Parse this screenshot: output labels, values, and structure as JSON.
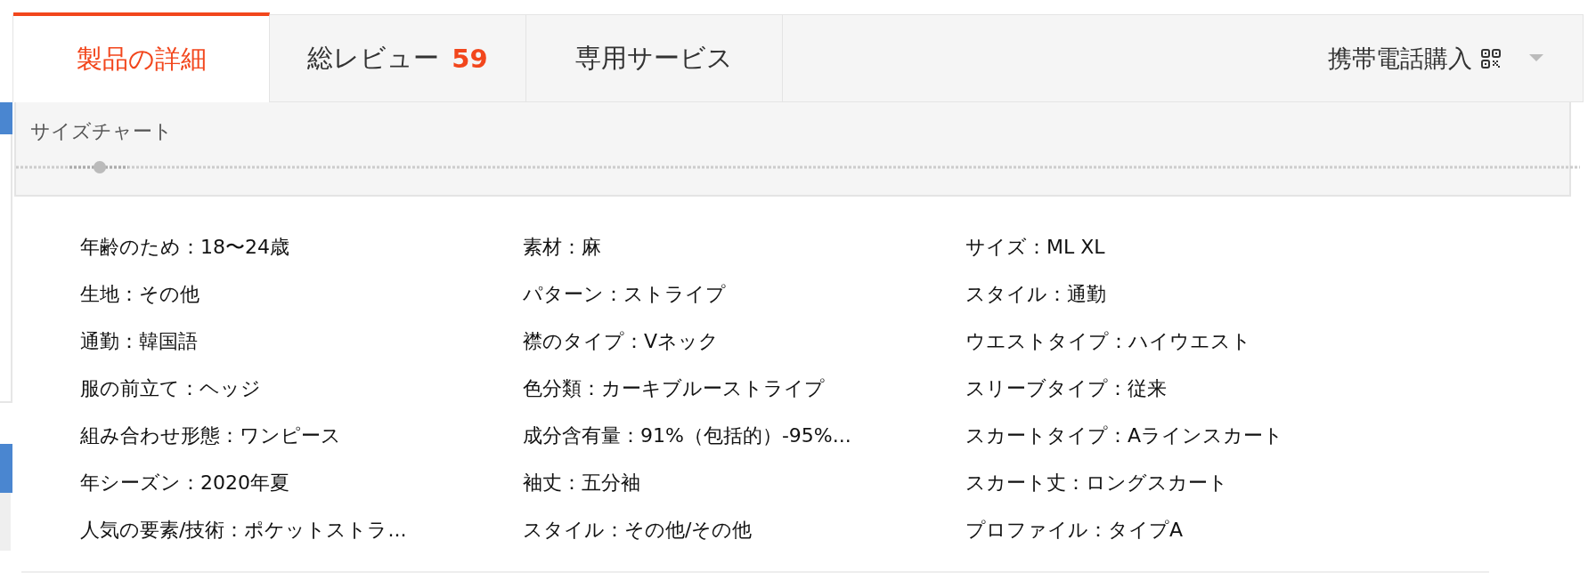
{
  "tabs": [
    {
      "label": "製品の詳細",
      "selected": true
    },
    {
      "label": "総レビュー",
      "count": "59",
      "selected": false
    },
    {
      "label": "専用サービス",
      "selected": false
    }
  ],
  "mobile_purchase": {
    "label": "携帯電話購入"
  },
  "size_chart": {
    "title": "サイズチャート"
  },
  "attributes": [
    [
      "年齢のため：18〜24歳",
      "生地：その他",
      "通勤：韓国語",
      "服の前立て：ヘッジ",
      "組み合わせ形態：ワンピース",
      "年シーズン：2020年夏",
      "人気の要素/技術：ポケットストラ..."
    ],
    [
      "素材：麻",
      "パターン：ストライプ",
      "襟のタイプ：Vネック",
      "色分類：カーキブルーストライプ",
      "成分含有量：91%（包括的）-95%...",
      "袖丈：五分袖",
      "スタイル：その他/その他"
    ],
    [
      "サイズ：ML XL",
      "スタイル：通勤",
      "ウエストタイプ：ハイウエスト",
      "スリーブタイプ：従来",
      "スカートタイプ：Aラインスカート",
      "スカート丈：ロングスカート",
      "プロファイル：タイプA"
    ]
  ]
}
